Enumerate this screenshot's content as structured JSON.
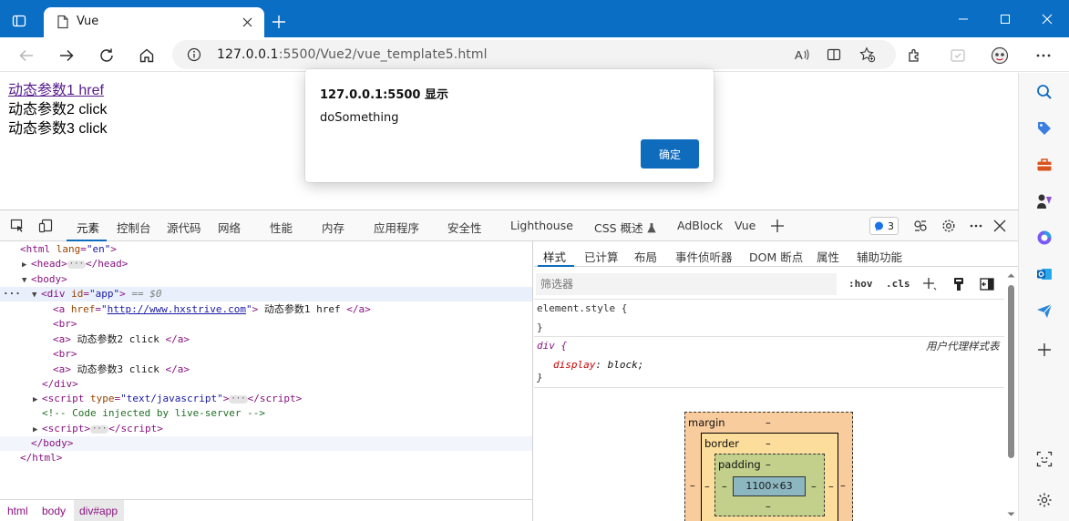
{
  "browser": {
    "tab_title": "Vue",
    "url_host": "127.0.0.1",
    "url_rest": ":5500/Vue2/vue_template5.html"
  },
  "page": {
    "link1": "动态参数1 href",
    "link2": "动态参数2 click",
    "link3": "动态参数3 click"
  },
  "alert": {
    "title": "127.0.0.1:5500 显示",
    "message": "doSomething",
    "ok_label": "确定"
  },
  "devtools": {
    "tabs": [
      "元素",
      "控制台",
      "源代码",
      "网络",
      "性能",
      "内存",
      "应用程序",
      "安全性",
      "Lighthouse",
      "CSS 概述",
      "AdBlock",
      "Vue"
    ],
    "active_tab": "元素",
    "issues_count": "3",
    "dom": {
      "html_open_tag": "html",
      "html_lang_attr": "lang",
      "html_lang_val": "\"en\"",
      "head_tag": "head",
      "body_tag": "body",
      "div_tag": "div",
      "div_id_attr": "id",
      "div_id_val": "\"app\"",
      "div_dollar": "== $0",
      "a1_attr": "href",
      "a1_url": "http://www.hxstrive.com",
      "a1_text": "动态参数1 href",
      "br_tag": "br",
      "a2_text": "动态参数2 click",
      "a3_text": "动态参数3 click",
      "script_tag": "script",
      "script_type_attr": "type",
      "script_type_val": "\"text/javascript\"",
      "comment": "<!-- Code injected by live-server -->"
    },
    "breadcrumbs": [
      "html",
      "body",
      "div#app"
    ],
    "styles": {
      "tabs": [
        "样式",
        "已计算",
        "布局",
        "事件侦听器",
        "DOM 断点",
        "属性",
        "辅助功能"
      ],
      "filter_placeholder": "筛选器",
      "hov": ":hov",
      "cls": ".cls",
      "element_style": "element.style {",
      "close_brace": "}",
      "div_selector": "div {",
      "user_agent_label": "用户代理样式表",
      "prop_name": "display",
      "prop_value": "block;"
    },
    "box_model": {
      "margin_label": "margin",
      "border_label": "border",
      "padding_label": "padding",
      "content_size": "1100×63",
      "dash": "–"
    }
  }
}
